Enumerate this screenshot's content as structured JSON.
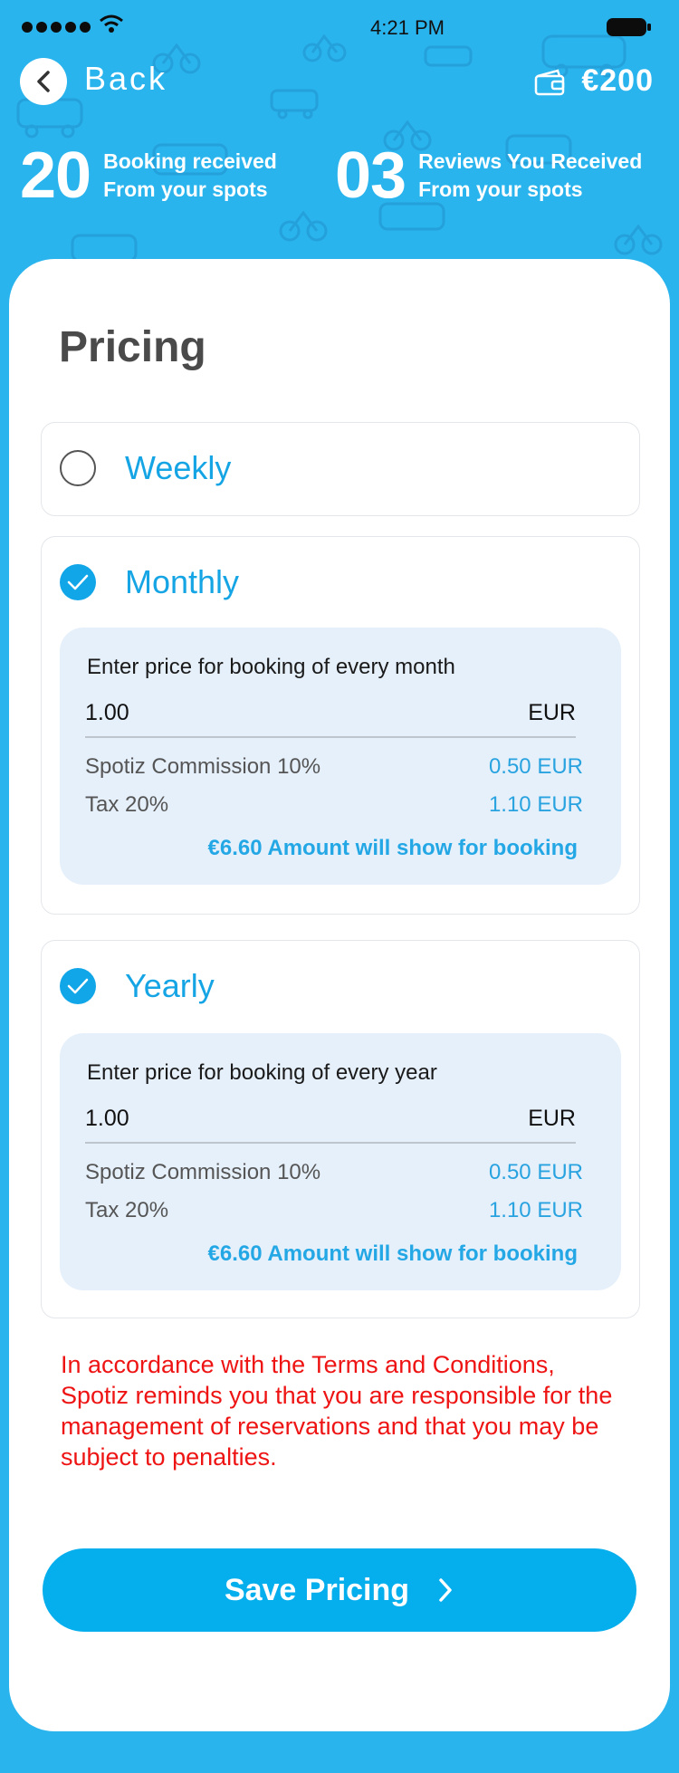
{
  "status_bar": {
    "time": "4:21 PM",
    "signal_icon": "signal-dots-icon",
    "wifi_icon": "wifi-icon",
    "battery_icon": "battery-icon"
  },
  "header": {
    "back_label": "Back",
    "wallet_amount": "€200",
    "stats": [
      {
        "number": "20",
        "line1": "Booking received",
        "line2": "From your spots"
      },
      {
        "number": "03",
        "line1": "Reviews You Received",
        "line2": "From your spots"
      }
    ]
  },
  "page": {
    "title": "Pricing"
  },
  "options": [
    {
      "label": "Weekly",
      "checked": false
    },
    {
      "label": "Monthly",
      "checked": true,
      "box": {
        "title": "Enter price for booking of every month",
        "value": "1.00",
        "currency": "EUR",
        "commission_label": "Spotiz Commission 10%",
        "commission_value": "0.50 EUR",
        "tax_label": "Tax 20%",
        "tax_value": "1.10 EUR",
        "total": "€6.60 Amount will show for booking"
      }
    },
    {
      "label": "Yearly",
      "checked": true,
      "box": {
        "title": "Enter price for booking of every year",
        "value": "1.00",
        "currency": "EUR",
        "commission_label": "Spotiz Commission 10%",
        "commission_value": "0.50 EUR",
        "tax_label": "Tax 20%",
        "tax_value": "1.10 EUR",
        "total": "€6.60 Amount will show for booking"
      }
    }
  ],
  "notice": "In accordance with the Terms and Conditions, Spotiz reminds you that you are responsible for the management of reservations and that you may be subject to penalties.",
  "save_button": {
    "label": "Save Pricing"
  },
  "colors": {
    "brand": "#2ab4ee",
    "accent": "#05aeec",
    "warning": "#ee1414",
    "box": "#e6f0fb"
  }
}
